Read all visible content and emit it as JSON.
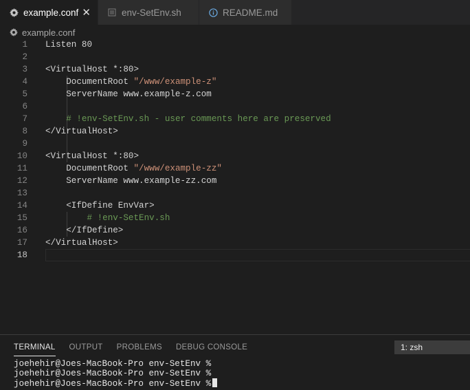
{
  "tabs": [
    {
      "label": "example.conf",
      "icon": "gear-icon",
      "active": true
    },
    {
      "label": "env-SetEnv.sh",
      "icon": "file-lines-icon",
      "active": false
    },
    {
      "label": "README.md",
      "icon": "info-icon",
      "active": false
    }
  ],
  "breadcrumb": {
    "file": "example.conf",
    "icon": "gear-icon"
  },
  "editor": {
    "current_line": "18",
    "lines": [
      {
        "n": "1",
        "pre": "Listen 80",
        "str": "",
        "cmt": ""
      },
      {
        "n": "2",
        "pre": "",
        "str": "",
        "cmt": ""
      },
      {
        "n": "3",
        "pre": "<VirtualHost *:80>",
        "str": "",
        "cmt": ""
      },
      {
        "n": "4",
        "pre": "    DocumentRoot ",
        "str": "\"/www/example-z\"",
        "cmt": ""
      },
      {
        "n": "5",
        "pre": "    ServerName www.example-z.com",
        "str": "",
        "cmt": ""
      },
      {
        "n": "6",
        "pre": "",
        "str": "",
        "cmt": ""
      },
      {
        "n": "7",
        "pre": "    ",
        "str": "",
        "cmt": "# !env-SetEnv.sh - user comments here are preserved"
      },
      {
        "n": "8",
        "pre": "</VirtualHost>",
        "str": "",
        "cmt": ""
      },
      {
        "n": "9",
        "pre": "",
        "str": "",
        "cmt": ""
      },
      {
        "n": "10",
        "pre": "<VirtualHost *:80>",
        "str": "",
        "cmt": ""
      },
      {
        "n": "11",
        "pre": "    DocumentRoot ",
        "str": "\"/www/example-zz\"",
        "cmt": ""
      },
      {
        "n": "12",
        "pre": "    ServerName www.example-zz.com",
        "str": "",
        "cmt": ""
      },
      {
        "n": "13",
        "pre": "",
        "str": "",
        "cmt": ""
      },
      {
        "n": "14",
        "pre": "    <IfDefine EnvVar>",
        "str": "",
        "cmt": ""
      },
      {
        "n": "15",
        "pre": "        ",
        "str": "",
        "cmt": "# !env-SetEnv.sh"
      },
      {
        "n": "16",
        "pre": "    </IfDefine>",
        "str": "",
        "cmt": ""
      },
      {
        "n": "17",
        "pre": "</VirtualHost>",
        "str": "",
        "cmt": ""
      },
      {
        "n": "18",
        "pre": "",
        "str": "",
        "cmt": ""
      }
    ]
  },
  "panel": {
    "tabs": [
      {
        "label": "TERMINAL",
        "active": true
      },
      {
        "label": "OUTPUT",
        "active": false
      },
      {
        "label": "PROBLEMS",
        "active": false
      },
      {
        "label": "DEBUG CONSOLE",
        "active": false
      }
    ],
    "shell_select": "1: zsh",
    "terminal_lines": [
      "joehehir@Joes-MacBook-Pro env-SetEnv %",
      "joehehir@Joes-MacBook-Pro env-SetEnv %",
      "joehehir@Joes-MacBook-Pro env-SetEnv %"
    ]
  },
  "colors": {
    "string": "#ce9178",
    "comment": "#6a9955",
    "background": "#1e1e1e"
  }
}
